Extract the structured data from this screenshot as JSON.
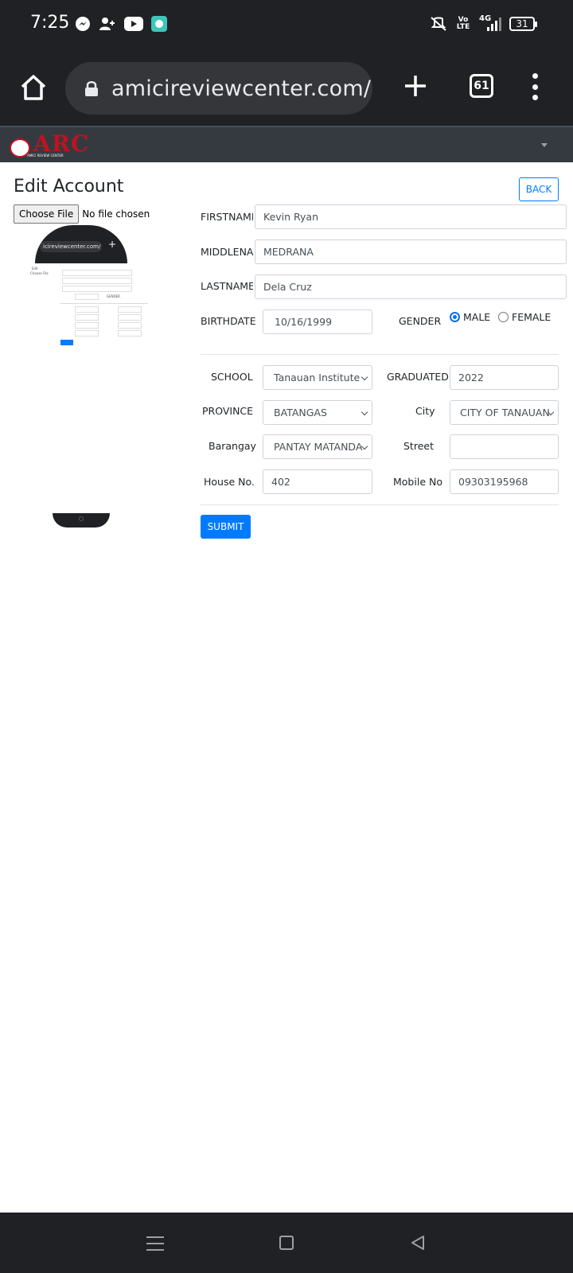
{
  "status_bar": {
    "time": "7:25",
    "left_icons": [
      "messenger-icon",
      "add-contact-icon",
      "youtube-icon",
      "chat-bubble-icon"
    ],
    "right_icons": [
      "mute-icon",
      "volte-icon",
      "4g-signal-icon",
      "battery-icon"
    ],
    "volte": "Vo LTE",
    "network": "4G",
    "battery": "31"
  },
  "browser": {
    "url": "amicireviewcenter.com/",
    "tab_count": "61"
  },
  "site": {
    "logo_text": "ARC",
    "logo_tagline": "AMICI REVIEW CENTER"
  },
  "page": {
    "title": "Edit Account",
    "back_label": "BACK",
    "file_button": "Choose File",
    "file_status": "No file chosen",
    "submit_label": "SUBMIT"
  },
  "photo_preview": {
    "url": "icireviewcenter.com/"
  },
  "form": {
    "firstname": {
      "label": "FIRSTNAME",
      "value": "Kevin Ryan"
    },
    "middlename": {
      "label": "MIDDLENAME",
      "value": "MEDRANA"
    },
    "lastname": {
      "label": "LASTNAME",
      "value": "Dela Cruz"
    },
    "birthdate": {
      "label": "BIRTHDATE",
      "value": "10/16/1999"
    },
    "gender": {
      "label": "GENDER",
      "options": [
        "MALE",
        "FEMALE"
      ],
      "selected": "MALE"
    },
    "school": {
      "label": "SCHOOL",
      "value": "Tanauan Institute"
    },
    "graduated": {
      "label": "GRADUATED",
      "value": "2022"
    },
    "province": {
      "label": "PROVINCE",
      "value": "BATANGAS"
    },
    "city": {
      "label": "City",
      "value": "CITY OF TANAUAN"
    },
    "barangay": {
      "label": "Barangay",
      "value": "PANTAY MATANDA"
    },
    "street": {
      "label": "Street",
      "value": ""
    },
    "house_no": {
      "label": "House No.",
      "value": "402"
    },
    "mobile_no": {
      "label": "Mobile No",
      "value": "09303195968"
    }
  },
  "colors": {
    "primary": "#007bff",
    "navbar": "#343a40",
    "browser_chrome": "#202124",
    "logo_red": "#c1121f"
  }
}
